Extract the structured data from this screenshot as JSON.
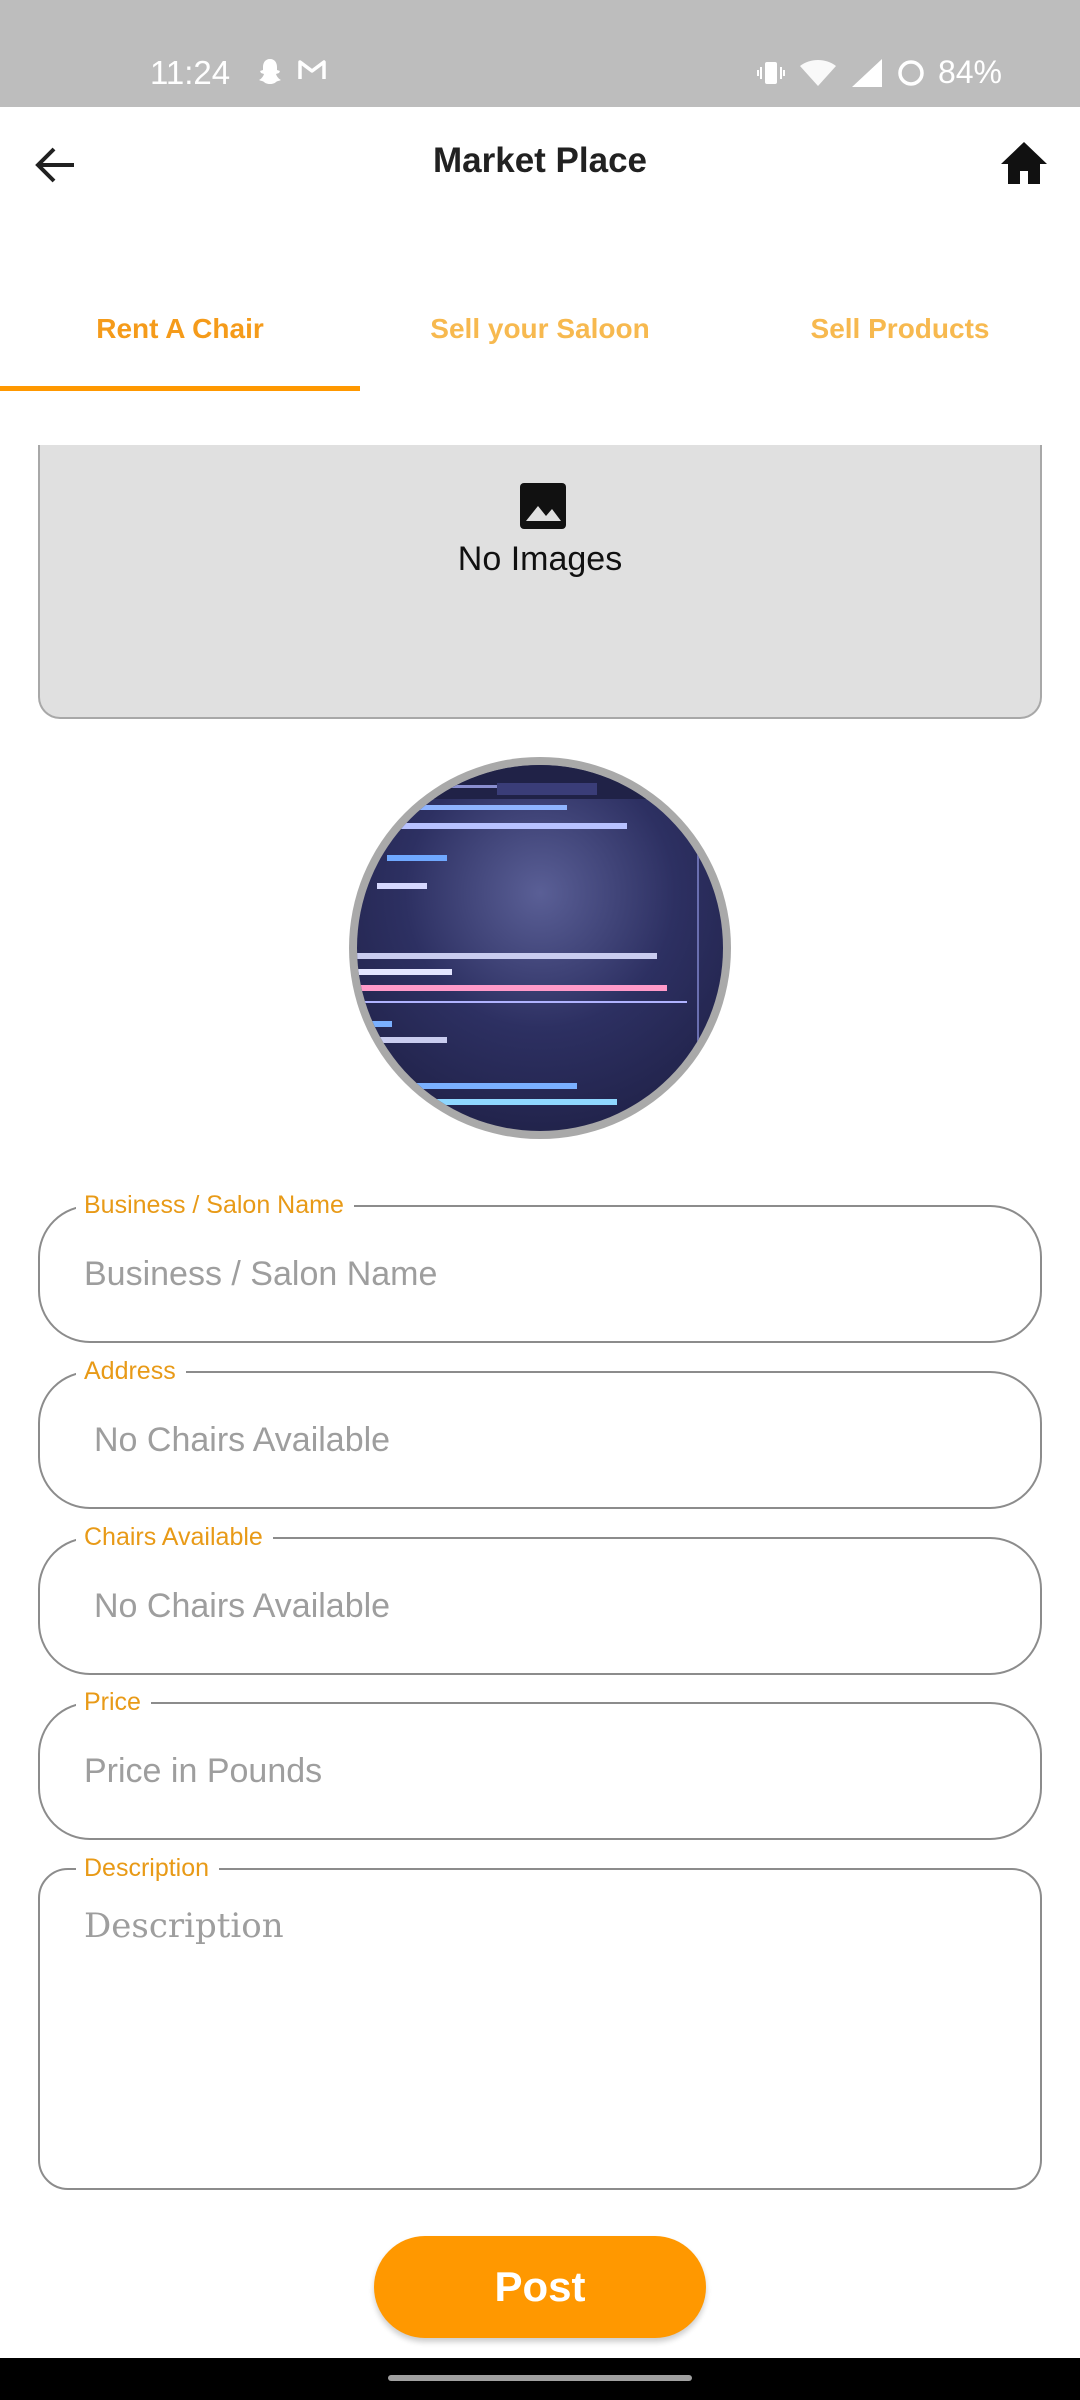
{
  "status_bar": {
    "time": "11:24",
    "battery": "84%",
    "left_icons": [
      "snapchat-icon",
      "gmail-icon"
    ],
    "right_icons": [
      "vibrate-icon",
      "wifi-icon",
      "signal-icon",
      "battery-icon"
    ]
  },
  "app_bar": {
    "title": "Market Place",
    "back_icon": "arrow-left-icon",
    "home_icon": "home-icon"
  },
  "tabs": [
    {
      "label": "Rent A Chair",
      "active": true
    },
    {
      "label": "Sell your Saloon",
      "active": false
    },
    {
      "label": "Sell Products",
      "active": false
    }
  ],
  "image_picker": {
    "icon": "image-icon",
    "text": "No Images"
  },
  "form": {
    "business_name": {
      "label": "Business / Salon Name",
      "placeholder": "Business / Salon Name"
    },
    "address": {
      "label": "Address",
      "placeholder": "No Chairs Available"
    },
    "chairs": {
      "label": "Chairs Available",
      "placeholder": "No Chairs Available"
    },
    "price": {
      "label": "Price",
      "placeholder": "Price in Pounds"
    },
    "description": {
      "label": "Description",
      "placeholder": "Description"
    }
  },
  "post_button": {
    "label": "Post"
  },
  "colors": {
    "accent": "#ff9800",
    "label": "#e89a17",
    "inactive_tab": "#f7b94f",
    "status_bar": "#bdbdbd"
  }
}
